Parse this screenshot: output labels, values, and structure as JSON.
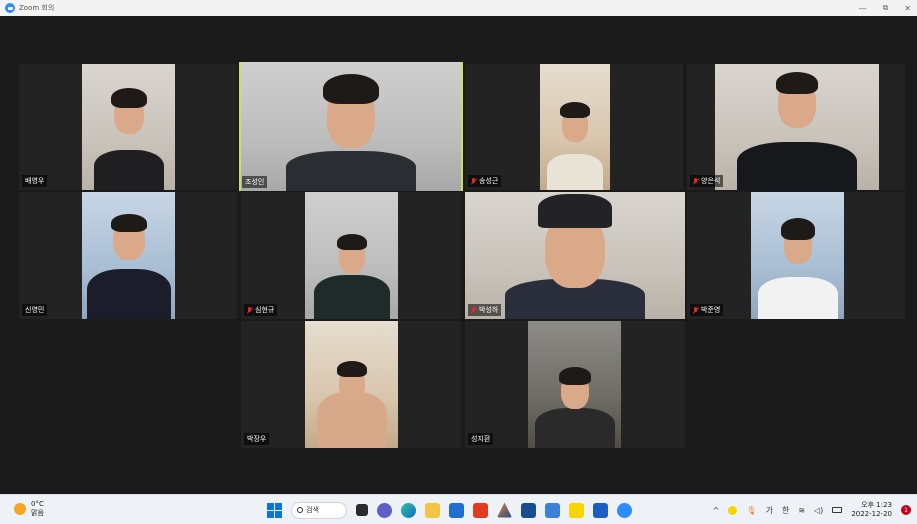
{
  "window": {
    "title": "Zoom 회의",
    "minimize": "—",
    "restore": "⧉",
    "close": "✕"
  },
  "participants": [
    {
      "name": "배영우",
      "muted": false,
      "active": false
    },
    {
      "name": "조성인",
      "muted": false,
      "active": true
    },
    {
      "name": "송성근",
      "muted": true,
      "active": false
    },
    {
      "name": "양은석",
      "muted": true,
      "active": false
    },
    {
      "name": "신영민",
      "muted": false,
      "active": false
    },
    {
      "name": "심현규",
      "muted": true,
      "active": false
    },
    {
      "name": "박성하",
      "muted": true,
      "active": false
    },
    {
      "name": "박준영",
      "muted": true,
      "active": false
    },
    {
      "name": "박장우",
      "muted": false,
      "active": false
    },
    {
      "name": "성지환",
      "muted": false,
      "active": false
    }
  ],
  "taskbar": {
    "weather_temp": "0°C",
    "weather_desc": "맑음",
    "search_label": "검색",
    "tray_ime_1": "가",
    "tray_ime_2": "한",
    "clock_time": "오후 1:23",
    "clock_date": "2022-12-20",
    "notification_count": "1"
  },
  "colors": {
    "active_speaker_border": "#c5e26b",
    "muted_icon": "#e02828",
    "zoom_blue": "#2d8cff"
  }
}
